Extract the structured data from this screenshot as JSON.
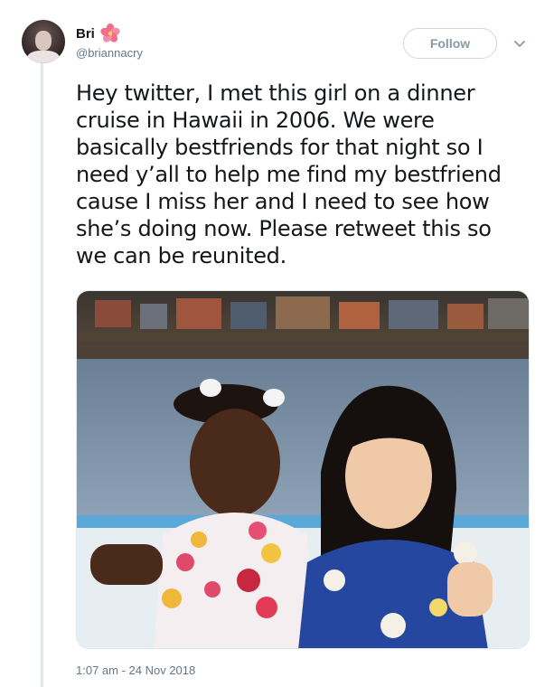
{
  "tweet": {
    "display_name": "Bri",
    "name_emoji": "hibiscus-flower-emoji",
    "handle": "@briannacry",
    "follow_label": "Follow",
    "text_lines": [
      "Hey twitter, I met this girl on a dinner",
      "cruise in Hawaii in 2006. We were",
      "basically bestfriends for that night so I",
      "need y’all to help me find my bestfriend",
      "cause I miss her and I need to see how",
      "she’s doing now. Please retweet this so",
      "we can be reunited."
    ],
    "timestamp": "1:07 am - 24 Nov 2018"
  },
  "colors": {
    "accent_gray": "#657786",
    "follow_border": "#cfd9de",
    "thread_line": "#e1e8ed"
  }
}
